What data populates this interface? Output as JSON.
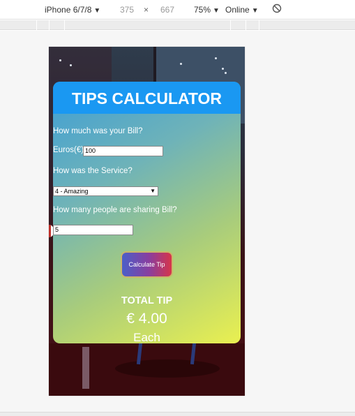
{
  "toolbar": {
    "device": "iPhone 6/7/8",
    "width": "375",
    "times": "×",
    "height": "667",
    "zoom": "75%",
    "network": "Online"
  },
  "card": {
    "title": "TIPS CALCULATOR",
    "bill_question": "How much was your Bill?",
    "currency_label": "Euros(€)",
    "bill_value": "100",
    "service_question": "How was the Service?",
    "service_selected": "4 - Amazing",
    "people_question": "How many people are sharing Bill?",
    "people_value": "5",
    "calculate_label": "Calculate Tip",
    "total_label": "TOTAL TIP",
    "total_value": "€ 4.00",
    "each_label": "Each"
  },
  "colors": {
    "header": "#1a98f2",
    "gradient_start": "#3e9ed6",
    "gradient_end": "#eaf050",
    "button_start": "#4b5fc8",
    "button_end": "#d6354a"
  },
  "icons": {
    "rotate": "rotate-icon",
    "dropdown": "caret-down-icon"
  }
}
